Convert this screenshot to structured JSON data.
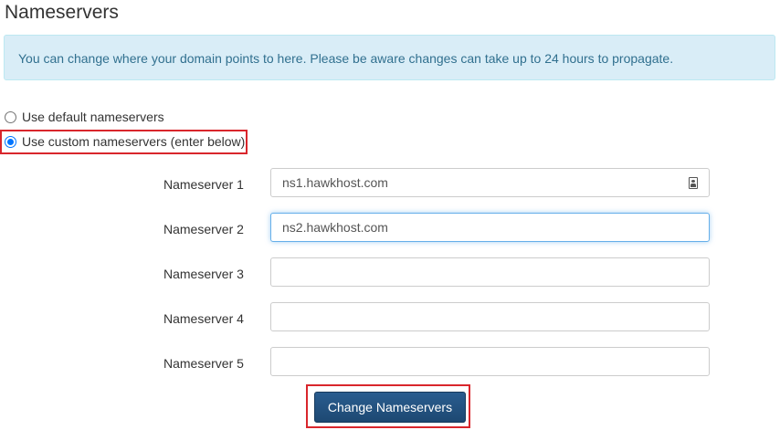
{
  "page": {
    "title": "Nameservers"
  },
  "alert": {
    "text": "You can change where your domain points to here. Please be aware changes can take up to 24 hours to propagate."
  },
  "options": {
    "default_label": "Use default nameservers",
    "custom_label": "Use custom nameservers (enter below)",
    "selected": "custom"
  },
  "nameservers": [
    {
      "label": "Nameserver 1",
      "value": "ns1.hawkhost.com"
    },
    {
      "label": "Nameserver 2",
      "value": "ns2.hawkhost.com"
    },
    {
      "label": "Nameserver 3",
      "value": ""
    },
    {
      "label": "Nameserver 4",
      "value": ""
    },
    {
      "label": "Nameserver 5",
      "value": ""
    }
  ],
  "submit": {
    "label": "Change Nameservers"
  },
  "colors": {
    "alert_bg": "#d9edf7",
    "alert_text": "#31708f",
    "button_bg": "#1f4e79",
    "highlight": "#d9262c",
    "radio_accent": "#0075ff"
  },
  "icons": {
    "field_icon": "contact-card-icon"
  }
}
